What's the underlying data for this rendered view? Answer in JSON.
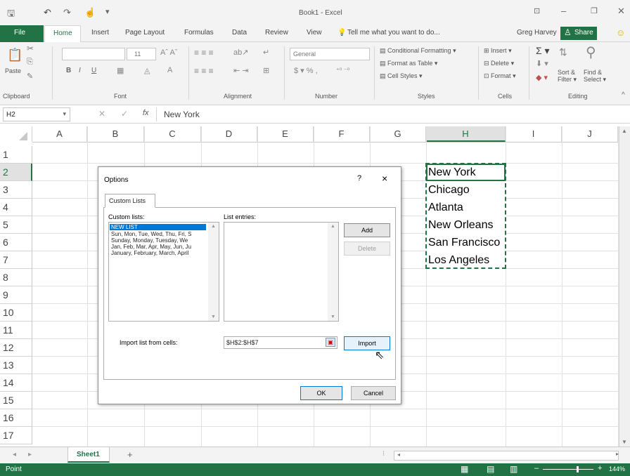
{
  "window": {
    "title": "Book1 - Excel",
    "user": "Greg Harvey",
    "share": "Share",
    "tell_me": "Tell me what you want to do..."
  },
  "tabs": [
    "File",
    "Home",
    "Insert",
    "Page Layout",
    "Formulas",
    "Data",
    "Review",
    "View"
  ],
  "ribbon": {
    "paste": "Paste",
    "font_size": "11",
    "number_format": "General",
    "conditional_formatting": "Conditional Formatting",
    "format_as_table": "Format as Table",
    "cell_styles": "Cell Styles",
    "insert": "Insert",
    "delete": "Delete",
    "format": "Format",
    "sort_filter_1": "Sort &",
    "sort_filter_2": "Filter",
    "find_select_1": "Find &",
    "find_select_2": "Select",
    "groups": [
      "Clipboard",
      "Font",
      "Alignment",
      "Number",
      "Styles",
      "Cells",
      "Editing"
    ]
  },
  "formula_bar": {
    "name_box": "H2",
    "fx": "fx",
    "value": "New York"
  },
  "columns": [
    "A",
    "B",
    "C",
    "D",
    "E",
    "F",
    "G",
    "H",
    "I",
    "J"
  ],
  "rows": [
    "1",
    "2",
    "3",
    "4",
    "5",
    "6",
    "7",
    "8",
    "9",
    "10",
    "11",
    "12",
    "13",
    "14",
    "15",
    "16",
    "17"
  ],
  "cells_h": [
    "New York",
    "Chicago",
    "Atlanta",
    "New Orleans",
    "San Francisco",
    "Los Angeles"
  ],
  "dialog": {
    "title": "Options",
    "help": "?",
    "close": "×",
    "tab": "Custom Lists",
    "custom_lists_label": "Custom lists:",
    "list_entries_label": "List entries:",
    "custom_lists": [
      "NEW LIST",
      "Sun, Mon, Tue, Wed, Thu, Fri, S",
      "Sunday, Monday, Tuesday, We",
      "Jan, Feb, Mar, Apr, May, Jun, Ju",
      "January, February, March, April"
    ],
    "add": "Add",
    "delete": "Delete",
    "import_label": "Import list from cells:",
    "import_value": "$H$2:$H$7",
    "import": "Import",
    "ok": "OK",
    "cancel": "Cancel"
  },
  "sheet": {
    "tab": "Sheet1",
    "add": "+"
  },
  "status": {
    "mode": "Point",
    "zoom": "144%"
  }
}
